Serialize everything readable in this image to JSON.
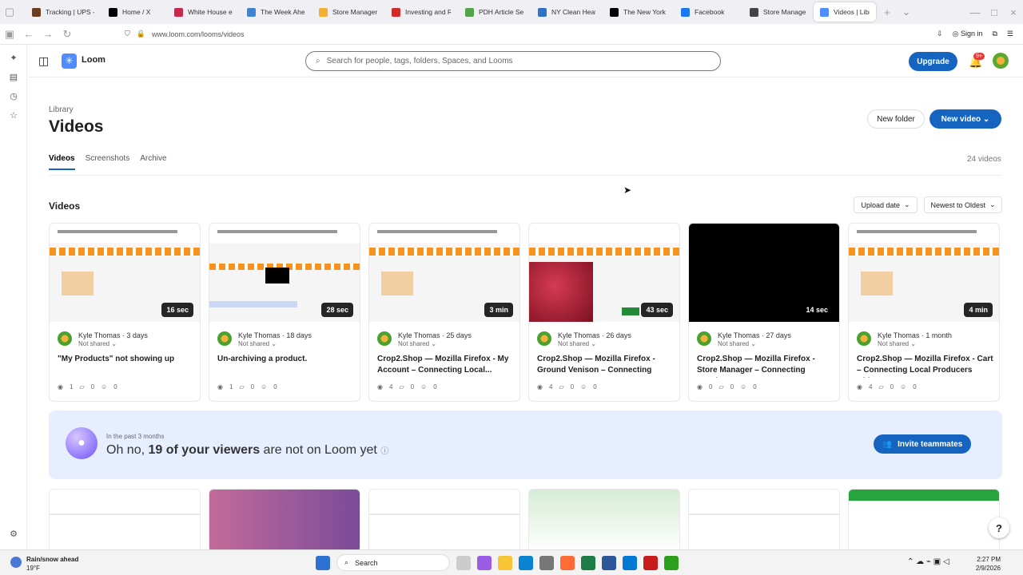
{
  "browser": {
    "tabs": [
      {
        "title": "Tracking | UPS - U",
        "color": "#6b3c1f",
        "active": false
      },
      {
        "title": "Home / X",
        "color": "#000000",
        "active": false
      },
      {
        "title": "White House exc",
        "color": "#c42a4b",
        "active": false
      },
      {
        "title": "The Week Ahead",
        "color": "#3e84d6",
        "active": false
      },
      {
        "title": "Store Manager –",
        "color": "#f2b134",
        "active": false
      },
      {
        "title": "Investing and Ret",
        "color": "#d02a2a",
        "active": false
      },
      {
        "title": "PDH Article Serie",
        "color": "#52a34a",
        "active": false
      },
      {
        "title": "NY Clean Heat Re",
        "color": "#2f73c8",
        "active": false
      },
      {
        "title": "The New York Tim",
        "color": "#000000",
        "active": false
      },
      {
        "title": "Facebook",
        "color": "#1877f2",
        "active": false
      },
      {
        "title": "Store Manager –",
        "color": "#444444",
        "active": false
      },
      {
        "title": "Videos | Libra",
        "color": "#4f8cff",
        "active": true
      }
    ],
    "url": "www.loom.com/looms/videos",
    "sign_in": "Sign in"
  },
  "app": {
    "brand": "Loom",
    "search_placeholder": "Search for people, tags, folders, Spaces, and Looms",
    "upgrade": "Upgrade",
    "notification_badge": "9+",
    "library": "Library",
    "title": "Videos",
    "new_folder": "New folder",
    "new_video": "New video",
    "tabs": [
      "Videos",
      "Screenshots",
      "Archive"
    ],
    "video_count": "24 videos",
    "section": "Videos",
    "sort_by": "Upload date",
    "sort_order": "Newest to Oldest",
    "cards": [
      {
        "owner": "Kyle Thomas",
        "age": "3 days",
        "share": "Not shared",
        "title": "\"My Products\" not showing up",
        "duration": "16 sec",
        "views": "1",
        "comments": "0",
        "reactions": "0",
        "thumb": "store"
      },
      {
        "owner": "Kyle Thomas",
        "age": "18 days",
        "share": "Not shared",
        "title": "Un-archiving a product.",
        "duration": "28 sec",
        "views": "1",
        "comments": "0",
        "reactions": "0",
        "thumb": "grid"
      },
      {
        "owner": "Kyle Thomas",
        "age": "25 days",
        "share": "Not shared",
        "title": "Crop2.Shop — Mozilla Firefox - My Account – Connecting Local...",
        "duration": "3 min",
        "views": "4",
        "comments": "0",
        "reactions": "0",
        "thumb": "store"
      },
      {
        "owner": "Kyle Thomas",
        "age": "26 days",
        "share": "Not shared",
        "title": "Crop2.Shop — Mozilla Firefox - Ground Venison – Connecting Loca...",
        "duration": "43 sec",
        "views": "4",
        "comments": "0",
        "reactions": "0",
        "thumb": "meat"
      },
      {
        "owner": "Kyle Thomas",
        "age": "27 days",
        "share": "Not shared",
        "title": "Crop2.Shop — Mozilla Firefox - Store Manager – Connecting Local...",
        "duration": "14 sec",
        "views": "0",
        "comments": "0",
        "reactions": "0",
        "thumb": "black"
      },
      {
        "owner": "Kyle Thomas",
        "age": "1 month",
        "share": "Not shared",
        "title": "Crop2.Shop — Mozilla Firefox - Cart – Connecting Local Producers with...",
        "duration": "4 min",
        "views": "4",
        "comments": "0",
        "reactions": "0",
        "thumb": "store"
      }
    ],
    "banner": {
      "small": "In the past 3 months",
      "prefix": "Oh no, ",
      "highlight": "19 of your viewers",
      "suffix": " are not on Loom yet",
      "button": "Invite teammates"
    }
  },
  "taskbar": {
    "weather_title": "Rain/snow ahead",
    "temp": "19°F",
    "search": "Search",
    "time": "2:27 PM",
    "date": "2/9/2026"
  }
}
